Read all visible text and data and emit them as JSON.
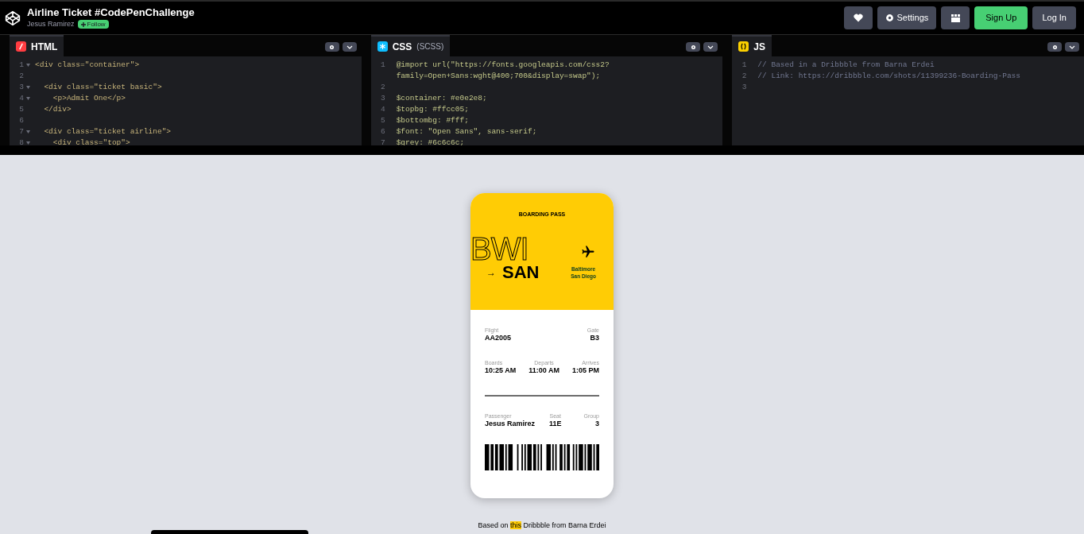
{
  "header": {
    "title": "Airline Ticket #CodePenChallenge",
    "author": "Jesus Ramirez",
    "follow": "Follow",
    "buttons": [
      {
        "kind": "heart"
      },
      {
        "kind": "settings",
        "label": "Settings"
      },
      {
        "kind": "layout"
      },
      {
        "kind": "signup",
        "label": "Sign Up"
      },
      {
        "kind": "login",
        "label": "Log In"
      }
    ]
  },
  "editors": [
    {
      "kind": "html",
      "title": "HTML",
      "lines": [
        {
          "n": "1",
          "text": "<div class=\"container\">",
          "fold": true
        },
        {
          "n": "2"
        },
        {
          "n": "3",
          "text": "  <div class=\"ticket basic\">",
          "fold": true
        },
        {
          "n": "4",
          "text": "    <p>Admit One</p>",
          "fold": true
        },
        {
          "n": "5",
          "text": "  </div>"
        },
        {
          "n": "6"
        },
        {
          "n": "7",
          "text": "  <div class=\"ticket airline\">",
          "fold": true
        },
        {
          "n": "8",
          "text": "    <div class=\"top\">",
          "fold": true
        }
      ]
    },
    {
      "kind": "css",
      "title": "CSS",
      "subtitle": "(SCSS)",
      "lines": [
        {
          "n": "1",
          "text": "@import url(\"https://fonts.googleapis.com/css2?"
        },
        {
          "text": "family=Open+Sans:wght@400;700&display=swap\");"
        },
        {
          "n": "2"
        },
        {
          "n": "3",
          "text": "$container: #e0e2e8;"
        },
        {
          "n": "4",
          "text": "$topbg: #ffcc05;"
        },
        {
          "n": "5",
          "text": "$bottombg: #fff;"
        },
        {
          "n": "6",
          "text": "$font: \"Open Sans\", sans-serif;"
        },
        {
          "n": "7",
          "text": "$grey: #6c6c6c;"
        }
      ]
    },
    {
      "kind": "js",
      "title": "JS",
      "lines": [
        {
          "n": "1",
          "text": "// Based in a Dribbble from Barna Erdei"
        },
        {
          "n": "2",
          "text": "// Link: https://dribbble.com/shots/11399236-Boarding-Pass"
        },
        {
          "n": "3"
        }
      ]
    }
  ],
  "ticket": {
    "title": "BOARDING PASS",
    "from": "BWI",
    "to": "SAN",
    "arrow": "→",
    "cities": [
      "Baltimore",
      "San Diego"
    ],
    "rows": [
      [
        {
          "label": "Flight",
          "value": "AA2005"
        },
        null,
        {
          "label": "Gate",
          "value": "B3"
        }
      ],
      [
        {
          "label": "Boards",
          "value": "10:25 AM"
        },
        {
          "label": "Departs",
          "value": "11:00 AM"
        },
        {
          "label": "Arrives",
          "value": "1:05 PM"
        }
      ]
    ],
    "passenger_row": [
      {
        "label": "Passenger",
        "value": "Jesus Ramirez"
      },
      {
        "label": "Seat",
        "value": "11E"
      },
      {
        "label": "Group",
        "value": "3"
      }
    ]
  },
  "footer": {
    "before": "Based on",
    "link": "this",
    "after": "Dribbble from Barna Erdei"
  }
}
